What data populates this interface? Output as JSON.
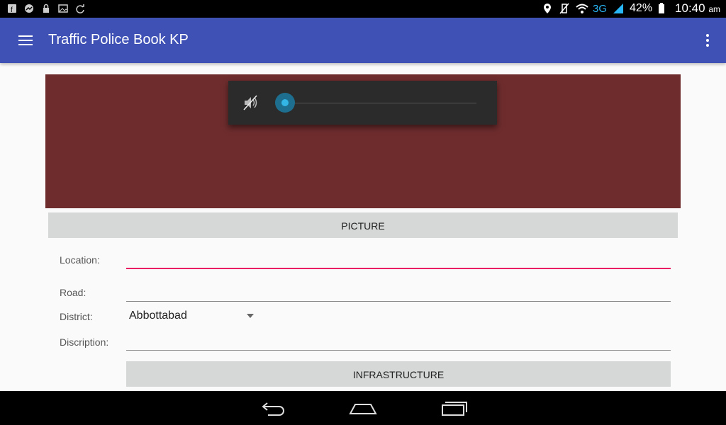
{
  "status_bar": {
    "battery": "42%",
    "network": "3G",
    "time": "10:40",
    "ampm": "am",
    "left_icons": [
      "facebook-icon",
      "messenger-icon",
      "lock-icon",
      "image-icon",
      "sync-icon"
    ],
    "right_icons": [
      "location-icon",
      "vibrate-off-icon",
      "wifi-icon",
      "signal-icon",
      "battery-icon"
    ]
  },
  "app_bar": {
    "title": "Traffic Police Book KP",
    "color": "#3f51b5"
  },
  "picture_area": {
    "background_color": "#6e2c2d",
    "volume_popup": {
      "icon": "volume-muted-icon",
      "level": 0
    }
  },
  "form": {
    "picture_button": "PICTURE",
    "location_label": "Location:",
    "road_label": "Road:",
    "district_label": "District:",
    "district_value": "Abbottabad",
    "description_label": "Discription:",
    "infrastructure_button": "INFRASTRUCTURE",
    "focus_color": "#e91e63"
  },
  "nav_bar": {
    "icons": [
      "back-icon",
      "home-icon",
      "recents-icon"
    ]
  }
}
